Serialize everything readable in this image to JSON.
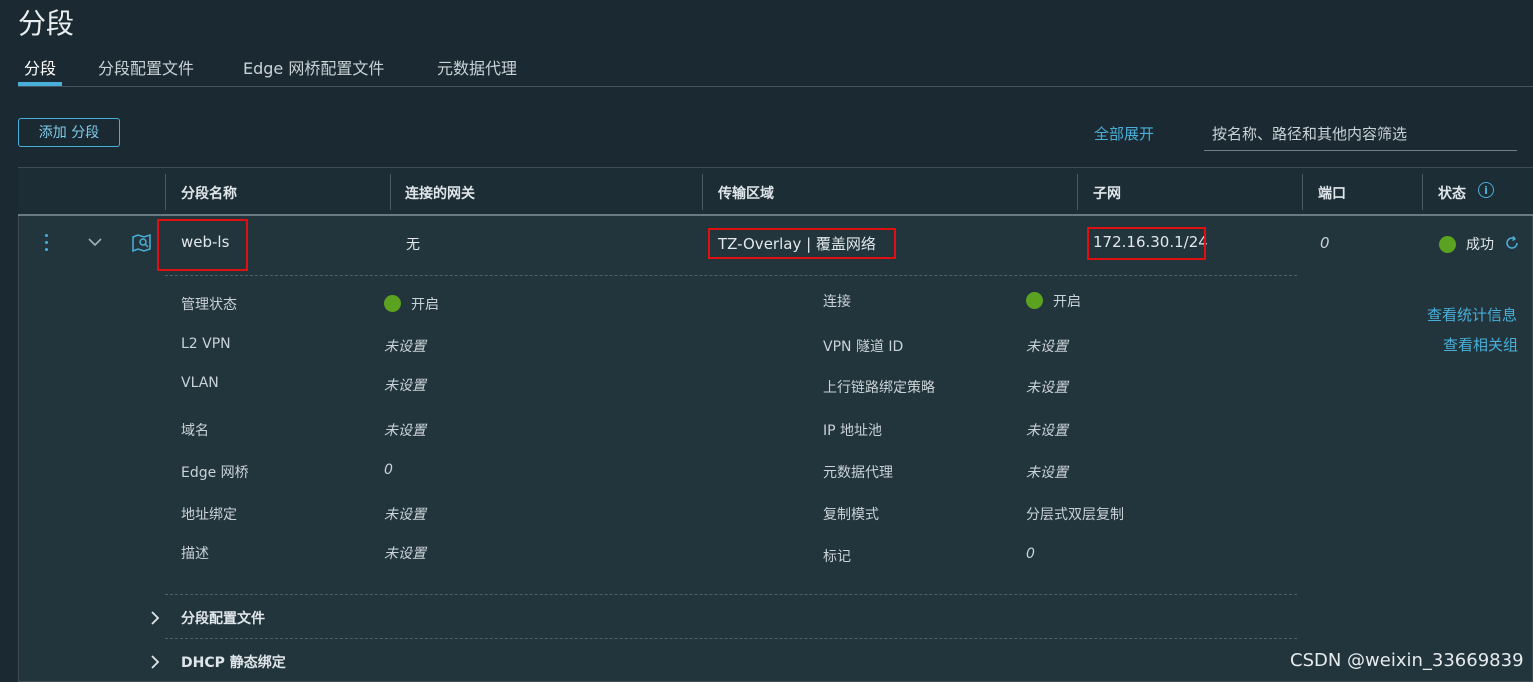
{
  "page_title": "分段",
  "tabs": [
    {
      "label": "分段",
      "active": true
    },
    {
      "label": "分段配置文件",
      "active": false
    },
    {
      "label": "Edge 网桥配置文件",
      "active": false
    },
    {
      "label": "元数据代理",
      "active": false
    }
  ],
  "toolbar": {
    "add_button": "添加 分段",
    "expand_all": "全部展开",
    "filter_placeholder": "按名称、路径和其他内容筛选"
  },
  "columns": [
    "分段名称",
    "连接的网关",
    "传输区域",
    "子网",
    "端口",
    "状态"
  ],
  "row": {
    "name": "web-ls",
    "gateway": "无",
    "transport_zone": "TZ-Overlay | 覆盖网络",
    "subnet": "172.16.30.1/24",
    "ports": "0",
    "status": "成功"
  },
  "details_left": [
    {
      "label": "管理状态",
      "value": "开启",
      "type": "toggle-on"
    },
    {
      "label": "L2 VPN",
      "value": "未设置",
      "type": "unset"
    },
    {
      "label": "VLAN",
      "value": "未设置",
      "type": "unset"
    },
    {
      "label": "域名",
      "value": "未设置",
      "type": "unset"
    },
    {
      "label": "Edge 网桥",
      "value": "0",
      "type": "unset"
    },
    {
      "label": "地址绑定",
      "value": "未设置",
      "type": "unset"
    },
    {
      "label": "描述",
      "value": "未设置",
      "type": "unset"
    }
  ],
  "details_right": [
    {
      "label": "连接",
      "value": "开启",
      "type": "toggle-on"
    },
    {
      "label": "VPN 隧道 ID",
      "value": "未设置",
      "type": "unset"
    },
    {
      "label": "上行链路绑定策略",
      "value": "未设置",
      "type": "unset"
    },
    {
      "label": "IP 地址池",
      "value": "未设置",
      "type": "unset"
    },
    {
      "label": "元数据代理",
      "value": "未设置",
      "type": "unset"
    },
    {
      "label": "复制模式",
      "value": "分层式双层复制",
      "type": "text"
    },
    {
      "label": "标记",
      "value": "0",
      "type": "unset"
    }
  ],
  "links": {
    "view_stats": "查看统计信息",
    "view_groups": "查看相关组"
  },
  "sections": [
    {
      "label": "分段配置文件"
    },
    {
      "label": "DHCP 静态绑定"
    }
  ],
  "watermark": "CSDN @weixin_33669839",
  "colors": {
    "accent": "#49afd9",
    "success": "#5aa220",
    "highlight_box": "#e01010",
    "background": "#1b2a32"
  }
}
